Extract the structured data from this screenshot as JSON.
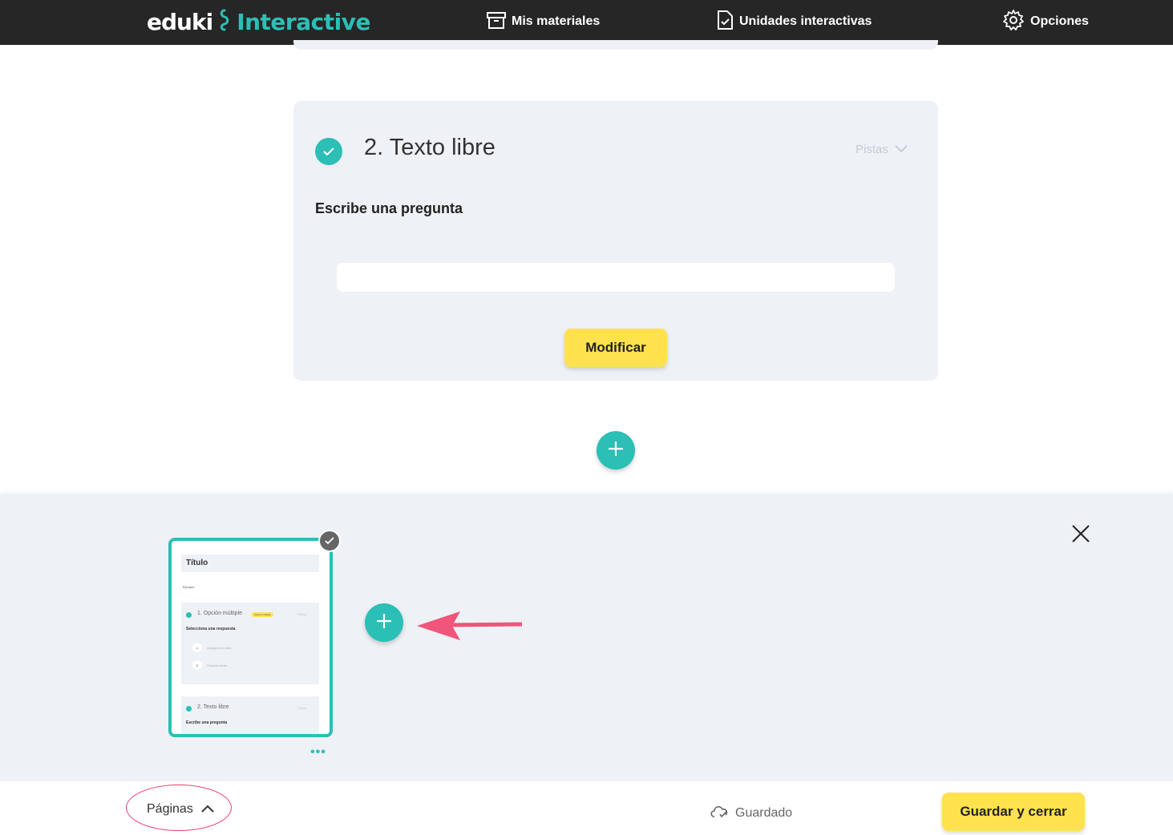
{
  "header": {
    "logo_word": "eduki",
    "logo_product": "Interactive",
    "nav": {
      "mis_materiales": "Mis materiales",
      "unidades": "Unidades interactivas",
      "opciones": "Opciones"
    }
  },
  "question_card": {
    "title": "2. Texto libre",
    "hints_label": "Pistas",
    "prompt": "Escribe una pregunta",
    "answer_value": "",
    "modify_button": "Modificar"
  },
  "pages_panel": {
    "thumbnail": {
      "title": "Título",
      "subtitle": "Ejemplo",
      "block1_title": "1. Opción múltiple",
      "block1_badge": "Opción múltiple",
      "block1_hint": "Pistas",
      "block1_prompt": "Selecciona una respuesta",
      "option_a_letter": "A",
      "option_a_text": "Margarita el salto",
      "option_b_letter": "B",
      "option_b_text": "Pradera verde",
      "block2_title": "2. Texto libre",
      "block2_hint": "Pistas",
      "block2_prompt": "Escribe una pregunta"
    },
    "more_label": "•••"
  },
  "footer": {
    "pages_toggle": "Páginas",
    "save_status": "Guardado",
    "save_close_button": "Guardar y cerrar"
  },
  "colors": {
    "accent": "#2bbfb6",
    "button_yellow": "#ffe24d",
    "topbar": "#262626",
    "annotation": "#e83e6c"
  }
}
